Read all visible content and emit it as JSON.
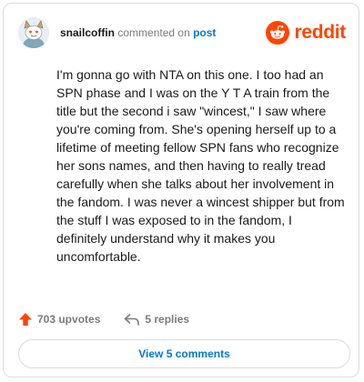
{
  "comment": {
    "username": "snailcoffin",
    "action_text": "commented on",
    "post_link_text": "post",
    "body": "I'm gonna go with NTA on this one. I too had an SPN phase and I was on the Y T A train from the title but the second i saw \"wincest,\" I saw where you're coming from. She's opening herself up to a lifetime of meeting fellow SPN fans who recognize her sons names, and then having to really tread carefully when she talks about her involvement in the fandom. I was never a wincest shipper but from the stuff I was exposed to in the fandom, I definitely understand why it makes you uncomfortable."
  },
  "brand": {
    "name": "reddit",
    "icon": "reddit-snoo-icon",
    "color": "#ff4500"
  },
  "stats": {
    "upvotes_label": "703 upvotes",
    "replies_label": "5 replies"
  },
  "actions": {
    "view_comments_label": "View 5 comments"
  },
  "colors": {
    "link": "#0079d3",
    "upvote": "#ff4500",
    "muted": "#7c7c7c"
  }
}
